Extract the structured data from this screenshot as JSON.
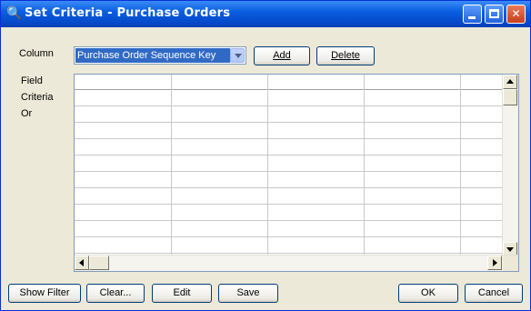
{
  "window": {
    "title": "Set Criteria - Purchase Orders",
    "icon": "search-icon",
    "controls": {
      "minimize": "minimize",
      "maximize": "maximize",
      "close": "close"
    }
  },
  "column_row": {
    "label": "Column",
    "selected_column": "Purchase Order Sequence Key",
    "add_label": "Add",
    "delete_label": "Delete"
  },
  "row_labels": [
    "Field",
    "Criteria",
    "Or"
  ],
  "grid": {
    "column_count": 5,
    "visible_rows": 12
  },
  "footer": {
    "show_filter_label": "Show Filter",
    "clear_label": "Clear...",
    "edit_label": "Edit",
    "save_label": "Save",
    "ok_label": "OK",
    "cancel_label": "Cancel"
  },
  "colors": {
    "titlebar": "#0a5fe0",
    "selection": "#316ac5",
    "dialog_bg": "#ece9d8"
  }
}
